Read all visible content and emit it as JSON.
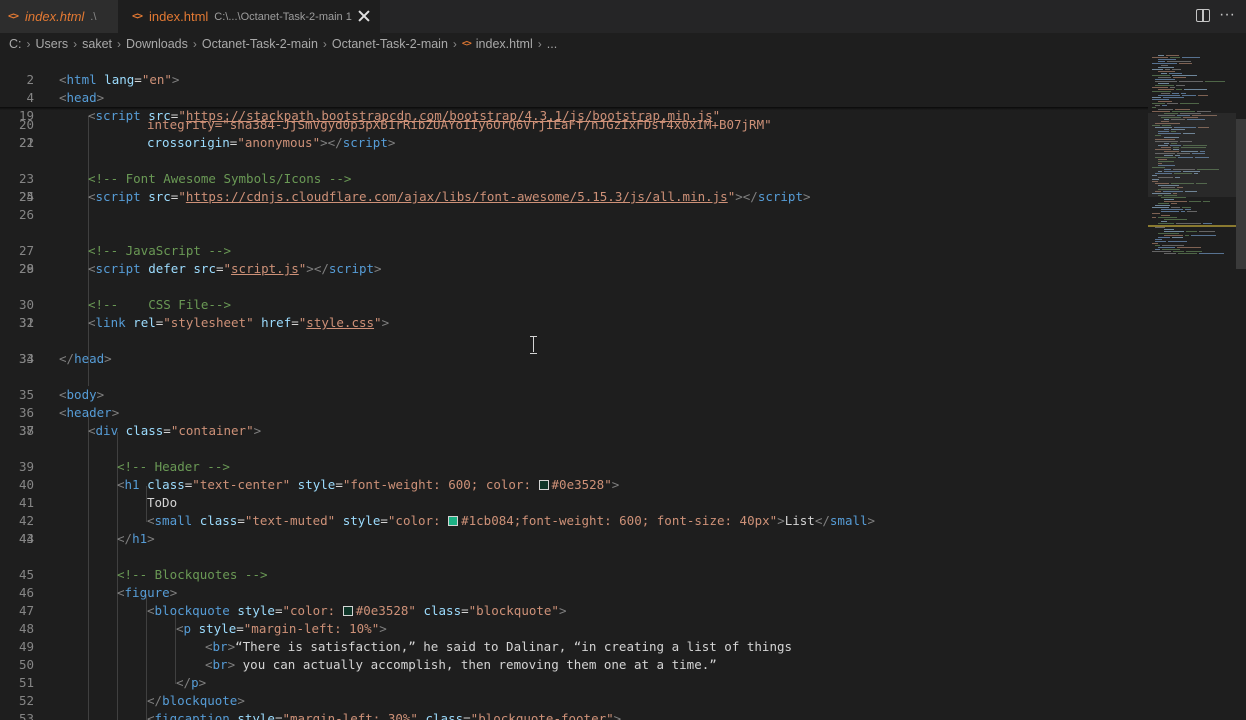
{
  "tabs": [
    {
      "name": "index.html",
      "path": ".\\"
    },
    {
      "name": "index.html",
      "path": "C:\\...\\Octanet-Task-2-main 1"
    }
  ],
  "breadcrumb": [
    "C:",
    "Users",
    "saket",
    "Downloads",
    "Octanet-Task-2-main",
    "Octanet-Task-2-main",
    "index.html",
    "..."
  ],
  "icons": {
    "file": "html-file-icon",
    "close": "close-icon",
    "split": "split-editor-icon",
    "more": "more-actions-icon"
  },
  "lines": [
    {
      "n": "2",
      "sticky": true
    },
    {
      "n": "4",
      "sticky": true
    },
    {
      "n": "19",
      "sticky": true
    },
    {
      "n": "20",
      "overlap": "integrity=\"sha384-JjSmVgyd0p3pXB1rRibZUAYoIIy6OrQ6VrjIEaFf/nJGzIxFDsf4x0xIM+B07jRM\""
    },
    {
      "n": "21"
    },
    {
      "n": "22"
    },
    {
      "n": "23"
    },
    {
      "n": "24"
    },
    {
      "n": "25"
    },
    {
      "n": "26"
    },
    {
      "n": "27"
    },
    {
      "n": "28"
    },
    {
      "n": "29"
    },
    {
      "n": "30"
    },
    {
      "n": "31"
    },
    {
      "n": "32"
    },
    {
      "n": "33"
    },
    {
      "n": "34"
    },
    {
      "n": "35"
    },
    {
      "n": "36"
    },
    {
      "n": "37"
    },
    {
      "n": "38"
    },
    {
      "n": "39"
    },
    {
      "n": "40"
    },
    {
      "n": "41"
    },
    {
      "n": "42"
    },
    {
      "n": "43"
    },
    {
      "n": "44"
    },
    {
      "n": "45"
    },
    {
      "n": "46"
    },
    {
      "n": "47"
    },
    {
      "n": "48"
    },
    {
      "n": "49"
    },
    {
      "n": "50"
    },
    {
      "n": "51"
    },
    {
      "n": "52"
    },
    {
      "n": "53"
    }
  ],
  "code": {
    "l2_tag": "html",
    "l2_attr": "lang",
    "l2_val": "\"en\"",
    "l4_tag": "head",
    "l19_tag": "script",
    "l19_attr": "src",
    "l19_url": "https://stackpath.bootstrapcdn.com/bootstrap/4.3.1/js/bootstrap.min.js",
    "l21_attr": "crossorigin",
    "l21_val": "\"anonymous\"",
    "l21_close": "script",
    "l23_comment": "<!-- Font Awesome Symbols/Icons -->",
    "l24_tag": "script",
    "l24_attr": "src",
    "l24_url": "https://cdnjs.cloudflare.com/ajax/libs/font-awesome/5.15.3/js/all.min.js",
    "l24_close": "script",
    "l27_comment": "<!-- JavaScript -->",
    "l28_tag": "script",
    "l28_attr1": "defer",
    "l28_attr2": "src",
    "l28_url": "script.js",
    "l28_close": "script",
    "l30_comment": "<!--    CSS File-->",
    "l31_tag": "link",
    "l31_attr1": "rel",
    "l31_val1": "\"stylesheet\"",
    "l31_attr2": "href",
    "l31_url": "style.css",
    "l33_tag": "head",
    "l35_tag": "body",
    "l36_tag": "header",
    "l37_tag": "div",
    "l37_attr": "class",
    "l37_val": "\"container\"",
    "l39_comment": "<!-- Header -->",
    "l40_tag": "h1",
    "l40_attr1": "class",
    "l40_val1": "\"text-center\"",
    "l40_attr2": "style",
    "l40_val2a": "\"font-weight: 600; color: ",
    "l40_val2b": "#0e3528\"",
    "l41_text": "ToDo",
    "l42_tag": "small",
    "l42_attr1": "class",
    "l42_val1": "\"text-muted\"",
    "l42_attr2": "style",
    "l42_val2a": "\"color: ",
    "l42_val2b": "#1cb084;font-weight: 600; font-size: 40px\"",
    "l42_text": "List",
    "l42_close": "small",
    "l43_tag": "h1",
    "l45_comment": "<!-- Blockquotes -->",
    "l46_tag": "figure",
    "l47_tag": "blockquote",
    "l47_attr1": "style",
    "l47_val1a": "\"color: ",
    "l47_val1b": "#0e3528\"",
    "l47_attr2": "class",
    "l47_val2": "\"blockquote\"",
    "l48_tag": "p",
    "l48_attr": "style",
    "l48_val": "\"margin-left: 10%\"",
    "l49_tag": "br",
    "l49_text": "“There is satisfaction,” he said to Dalinar, “in creating a list of things",
    "l50_tag": "br",
    "l50_text": " you can actually accomplish, then removing them one at a time.”",
    "l51_tag": "p",
    "l52_tag": "blockquote",
    "l53_tag": "figcaption",
    "l53_attr1": "style",
    "l53_val1": "\"margin-left: 30%\"",
    "l53_attr2": "class",
    "l53_val2": "\"blockquote-footer\""
  },
  "colors": {
    "dark_green": "#0e3528",
    "light_green": "#1cb084",
    "accent_orange": "#e37933"
  }
}
